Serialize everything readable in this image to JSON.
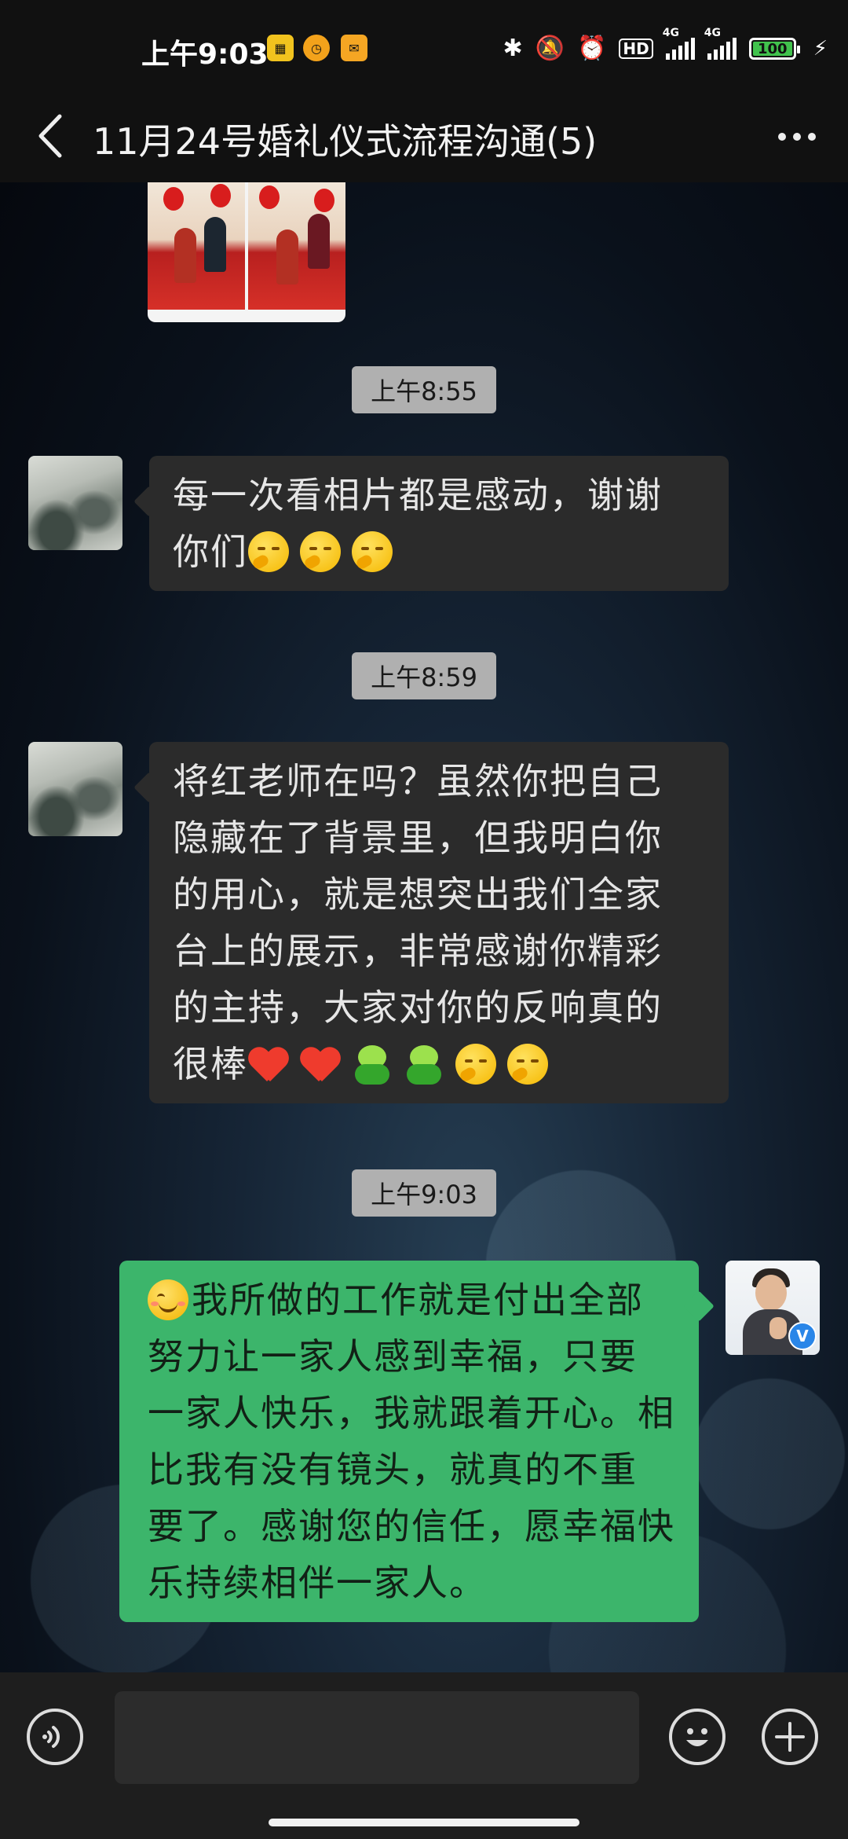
{
  "status_bar": {
    "time": "上午9:03",
    "app_icons": [
      "qr-wallet-icon",
      "clock-app-icon",
      "mail-app-icon"
    ],
    "signal_1_label": "4G",
    "signal_2_label": "4G",
    "hd_label": "HD",
    "battery": "100"
  },
  "header": {
    "title": "11月24号婚礼仪式流程沟通(5)"
  },
  "messages": [
    {
      "type": "timestamp",
      "text": "上午8:55"
    },
    {
      "type": "incoming",
      "lines": [
        "每一次看相片都是感动，谢谢",
        "你们"
      ],
      "emojis": [
        "thinking-emoji",
        "thinking-emoji",
        "thinking-emoji"
      ]
    },
    {
      "type": "timestamp",
      "text": "上午8:59"
    },
    {
      "type": "incoming",
      "lines": [
        "将红老师在吗？虽然你把自己",
        "隐藏在了背景里，但我明白你",
        "的用心，就是想突出我们全家",
        "台上的展示，非常感谢你精彩",
        "的主持，大家对你的反响真的",
        "很棒"
      ],
      "emojis": [
        "heart-emoji",
        "heart-emoji",
        "frog-emoji",
        "frog-emoji",
        "thinking-emoji",
        "thinking-emoji"
      ]
    },
    {
      "type": "timestamp",
      "text": "上午9:03"
    },
    {
      "type": "outgoing",
      "lines": [
        "我所做的工作就是付出全部",
        "努力让一家人感到幸福，只要",
        "一家人快乐，我就跟着开心。相",
        "比我有没有镜头，就真的不重",
        "要了。感谢您的信任，愿幸福快",
        "乐持续相伴一家人。"
      ],
      "emojis": [
        "smile-emoji"
      ]
    }
  ],
  "input": {
    "value": "",
    "placeholder": ""
  },
  "colors": {
    "outgoing_bubble": "#3cb56b",
    "incoming_bubble": "#2b2b2b",
    "timestamp_bg": "#b0b0b0"
  }
}
